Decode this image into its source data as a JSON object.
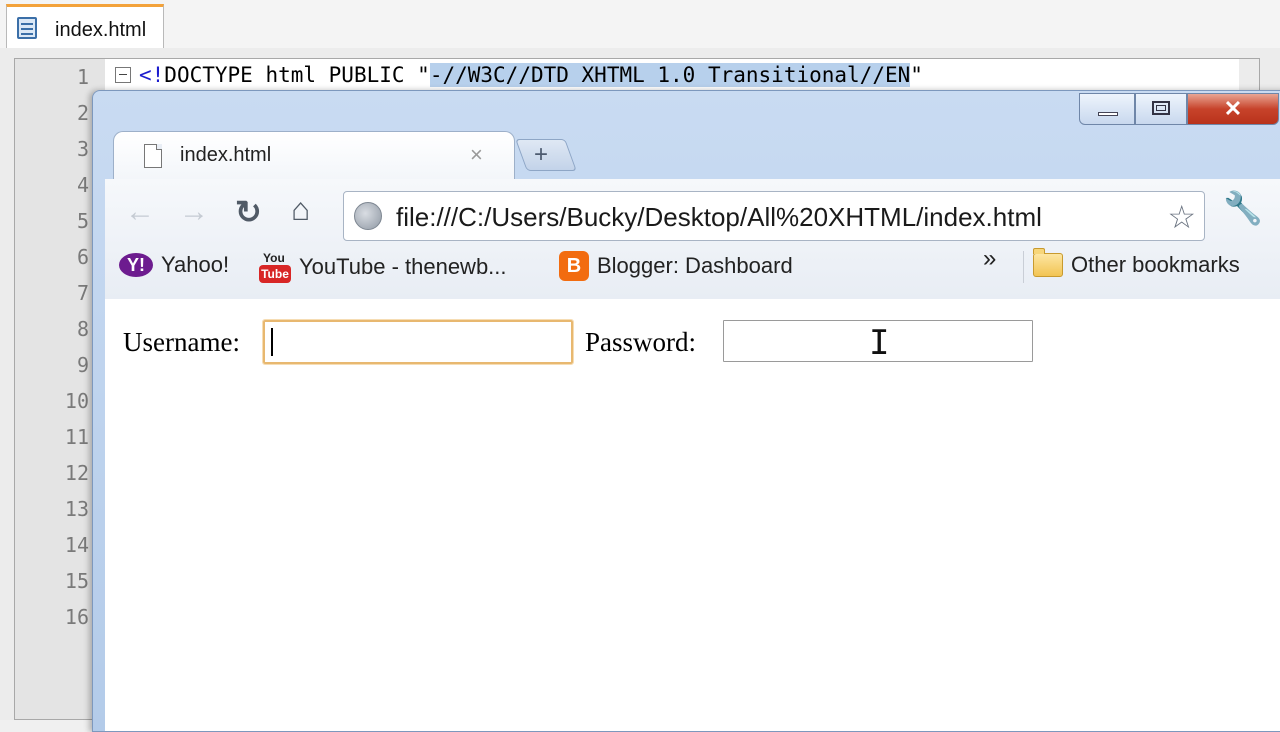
{
  "editor": {
    "tab_label": "index.html",
    "line_numbers": [
      "1",
      "2",
      "3",
      "4",
      "5",
      "6",
      "7",
      "8",
      "9",
      "10",
      "11",
      "12",
      "13",
      "14",
      "15",
      "16"
    ],
    "line1": {
      "open": "<!",
      "keyword": "DOCTYPE html PUBLIC \"",
      "highlighted": "-//W3C//DTD XHTML 1.0 Transitional//EN",
      "close": "\""
    }
  },
  "browser": {
    "tab_title": "index.html",
    "tab_close": "×",
    "new_tab": "+",
    "close_glyph": "✕",
    "url": "file:///C:/Users/Bucky/Desktop/All%20XHTML/index.html",
    "nav_glyphs": {
      "back": "←",
      "forward": "→",
      "reload": "↻",
      "home": "⌂",
      "star": "☆",
      "wrench": "🔧"
    },
    "bookmarks": [
      {
        "label": "Yahoo!",
        "icon": "yahoo-icon",
        "glyph": "Y!"
      },
      {
        "label": "YouTube - thenewb...",
        "icon": "youtube-icon",
        "glyph_top": "You",
        "glyph_bottom": "Tube"
      },
      {
        "label": "Blogger: Dashboard",
        "icon": "blogger-icon",
        "glyph": "B"
      }
    ],
    "overflow_chevron": "»",
    "other_bookmarks": "Other bookmarks"
  },
  "page": {
    "username_label": "Username:",
    "username_value": "",
    "password_label": "Password:",
    "password_value": ""
  },
  "colors": {
    "tab_accent": "#f3a23a",
    "focus_border": "#e8b870",
    "close_button": "#c7432b",
    "yahoo": "#6d1c8f",
    "youtube": "#d82626",
    "blogger": "#f26c10"
  }
}
